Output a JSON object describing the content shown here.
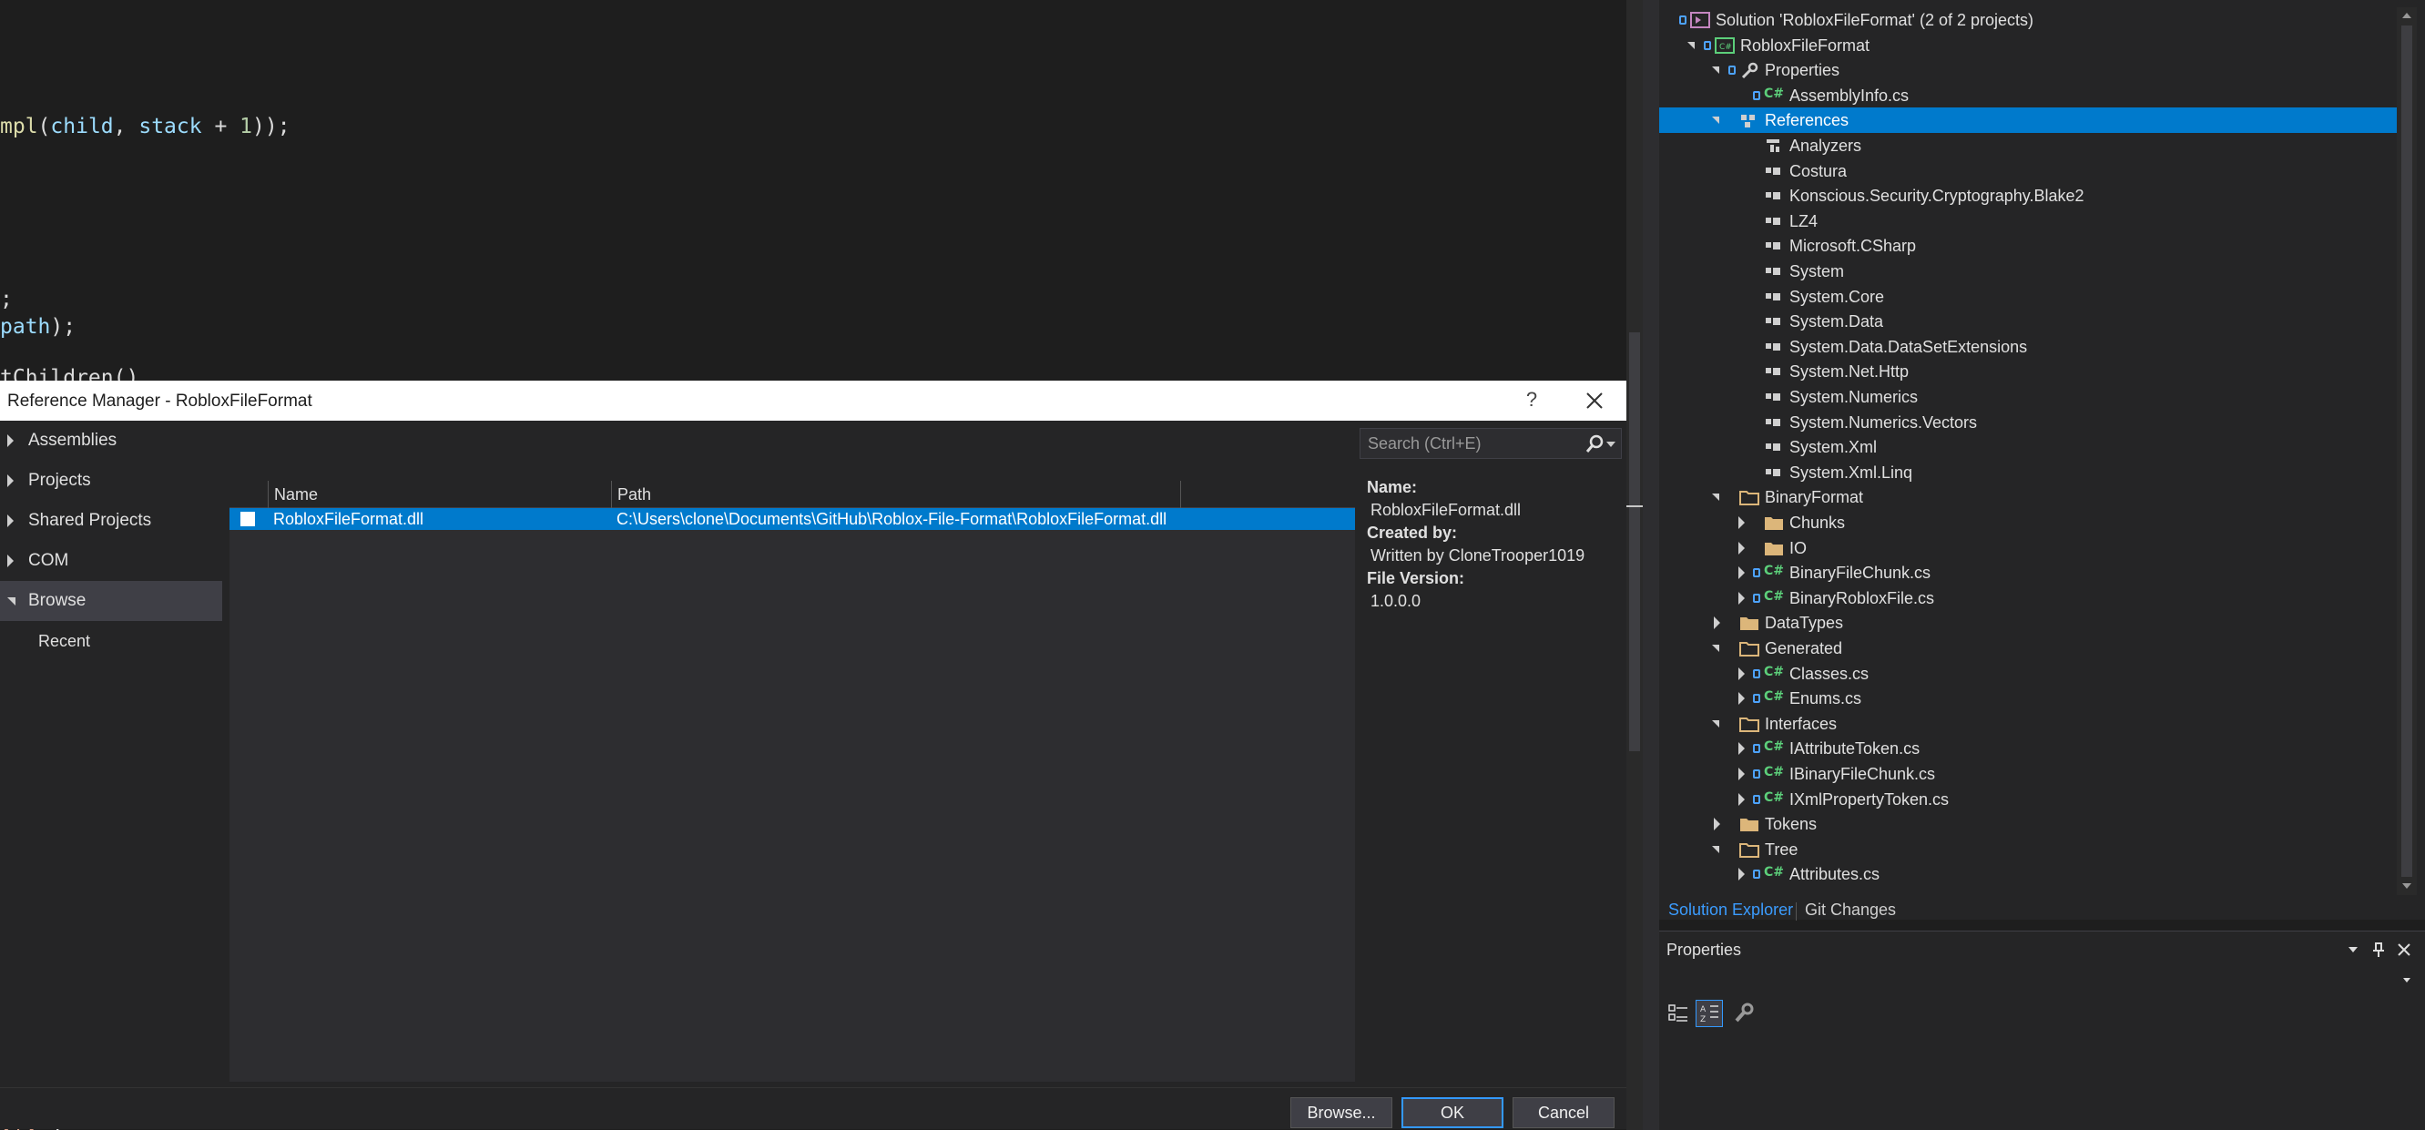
{
  "editor": {
    "lines": [
      {
        "parts": [
          {
            "t": "mpl",
            "c": "fn"
          },
          {
            "t": "(",
            "c": ""
          },
          {
            "t": "child",
            "c": "var"
          },
          {
            "t": ", ",
            "c": ""
          },
          {
            "t": "stack",
            "c": "var"
          },
          {
            "t": " + ",
            "c": ""
          },
          {
            "t": "1",
            "c": "num"
          },
          {
            "t": "));",
            "c": ""
          }
        ]
      },
      {
        "parts": [
          {
            "t": ";",
            "c": ""
          }
        ]
      },
      {
        "parts": [
          {
            "t": "path",
            "c": "var"
          },
          {
            "t": ");",
            "c": ""
          }
        ]
      },
      {
        "parts": [
          {
            "t": "tChildren()",
            "c": ""
          }
        ]
      },
      {
        "parts": [
          {
            "t": "xlx",
            "c": "str"
          },
          {
            "t": "\");",
            "c": ""
          }
        ]
      }
    ]
  },
  "dialog": {
    "title": "Reference Manager - RobloxFileFormat",
    "help_label": "?",
    "sidebar": {
      "items": [
        {
          "label": "Assemblies",
          "expanded": false
        },
        {
          "label": "Projects",
          "expanded": false
        },
        {
          "label": "Shared Projects",
          "expanded": false
        },
        {
          "label": "COM",
          "expanded": false
        },
        {
          "label": "Browse",
          "expanded": true
        }
      ],
      "sub_items": [
        "Recent"
      ]
    },
    "columns": {
      "name": "Name",
      "path": "Path"
    },
    "rows": [
      {
        "name": "RobloxFileFormat.dll",
        "path": "C:\\Users\\clone\\Documents\\GitHub\\Roblox-File-Format\\RobloxFileFormat.dll",
        "checked": false
      }
    ],
    "search": {
      "placeholder": "Search (Ctrl+E)"
    },
    "details": {
      "name_label": "Name:",
      "name_value": "RobloxFileFormat.dll",
      "created_by_label": "Created by:",
      "created_by_value": "Written by CloneTrooper1019",
      "file_version_label": "File Version:",
      "file_version_value": "1.0.0.0"
    },
    "buttons": {
      "browse": "Browse...",
      "ok": "OK",
      "cancel": "Cancel"
    }
  },
  "solution_explorer": {
    "tree": [
      {
        "label": "Solution 'RobloxFileFormat' (2 of 2 projects)",
        "depth": 0,
        "caret": "none",
        "icon": "solution-icon",
        "lock": true
      },
      {
        "label": "RobloxFileFormat",
        "depth": 1,
        "caret": "down",
        "icon": "csproj-icon",
        "lock": true
      },
      {
        "label": "Properties",
        "depth": 2,
        "caret": "down",
        "icon": "wrench-icon",
        "lock": true
      },
      {
        "label": "AssemblyInfo.cs",
        "depth": 3,
        "caret": "none",
        "icon": "csharp-icon",
        "lock": true
      },
      {
        "label": "References",
        "depth": 2,
        "caret": "down",
        "icon": "references-icon",
        "lock": false,
        "selected": true
      },
      {
        "label": "Analyzers",
        "depth": 3,
        "caret": "none",
        "icon": "analyzer-icon",
        "lock": false
      },
      {
        "label": "Costura",
        "depth": 3,
        "caret": "none",
        "icon": "reference-icon",
        "lock": false
      },
      {
        "label": "Konscious.Security.Cryptography.Blake2",
        "depth": 3,
        "caret": "none",
        "icon": "reference-icon",
        "lock": false
      },
      {
        "label": "LZ4",
        "depth": 3,
        "caret": "none",
        "icon": "reference-icon",
        "lock": false
      },
      {
        "label": "Microsoft.CSharp",
        "depth": 3,
        "caret": "none",
        "icon": "reference-icon",
        "lock": false
      },
      {
        "label": "System",
        "depth": 3,
        "caret": "none",
        "icon": "reference-icon",
        "lock": false
      },
      {
        "label": "System.Core",
        "depth": 3,
        "caret": "none",
        "icon": "reference-icon",
        "lock": false
      },
      {
        "label": "System.Data",
        "depth": 3,
        "caret": "none",
        "icon": "reference-icon",
        "lock": false
      },
      {
        "label": "System.Data.DataSetExtensions",
        "depth": 3,
        "caret": "none",
        "icon": "reference-icon",
        "lock": false
      },
      {
        "label": "System.Net.Http",
        "depth": 3,
        "caret": "none",
        "icon": "reference-icon",
        "lock": false
      },
      {
        "label": "System.Numerics",
        "depth": 3,
        "caret": "none",
        "icon": "reference-icon",
        "lock": false
      },
      {
        "label": "System.Numerics.Vectors",
        "depth": 3,
        "caret": "none",
        "icon": "reference-icon",
        "lock": false
      },
      {
        "label": "System.Xml",
        "depth": 3,
        "caret": "none",
        "icon": "reference-icon",
        "lock": false
      },
      {
        "label": "System.Xml.Linq",
        "depth": 3,
        "caret": "none",
        "icon": "reference-icon",
        "lock": false
      },
      {
        "label": "BinaryFormat",
        "depth": 2,
        "caret": "down",
        "icon": "folder-open-icon",
        "lock": false
      },
      {
        "label": "Chunks",
        "depth": 3,
        "caret": "right",
        "icon": "folder-icon",
        "lock": false
      },
      {
        "label": "IO",
        "depth": 3,
        "caret": "right",
        "icon": "folder-icon",
        "lock": false
      },
      {
        "label": "BinaryFileChunk.cs",
        "depth": 3,
        "caret": "right",
        "icon": "csharp-icon",
        "lock": true
      },
      {
        "label": "BinaryRobloxFile.cs",
        "depth": 3,
        "caret": "right",
        "icon": "csharp-icon",
        "lock": true
      },
      {
        "label": "DataTypes",
        "depth": 2,
        "caret": "right",
        "icon": "folder-icon",
        "lock": false
      },
      {
        "label": "Generated",
        "depth": 2,
        "caret": "down",
        "icon": "folder-open-icon",
        "lock": false
      },
      {
        "label": "Classes.cs",
        "depth": 3,
        "caret": "right",
        "icon": "csharp-icon",
        "lock": true
      },
      {
        "label": "Enums.cs",
        "depth": 3,
        "caret": "right",
        "icon": "csharp-icon",
        "lock": true
      },
      {
        "label": "Interfaces",
        "depth": 2,
        "caret": "down",
        "icon": "folder-open-icon",
        "lock": false
      },
      {
        "label": "IAttributeToken.cs",
        "depth": 3,
        "caret": "right",
        "icon": "csharp-icon",
        "lock": true
      },
      {
        "label": "IBinaryFileChunk.cs",
        "depth": 3,
        "caret": "right",
        "icon": "csharp-icon",
        "lock": true
      },
      {
        "label": "IXmlPropertyToken.cs",
        "depth": 3,
        "caret": "right",
        "icon": "csharp-icon",
        "lock": true
      },
      {
        "label": "Tokens",
        "depth": 2,
        "caret": "right",
        "icon": "folder-icon",
        "lock": false
      },
      {
        "label": "Tree",
        "depth": 2,
        "caret": "down",
        "icon": "folder-open-icon",
        "lock": false
      },
      {
        "label": "Attributes.cs",
        "depth": 3,
        "caret": "right",
        "icon": "csharp-icon",
        "lock": true
      }
    ],
    "tabs": {
      "solution_explorer": "Solution Explorer",
      "git_changes": "Git Changes"
    }
  },
  "properties": {
    "title": "Properties"
  },
  "colors": {
    "accent": "#007acc",
    "selection": "#007acc",
    "background": "#1e1e1e",
    "panel": "#252526",
    "csharp": "#5ccf7a",
    "folder": "#dcb67a"
  }
}
